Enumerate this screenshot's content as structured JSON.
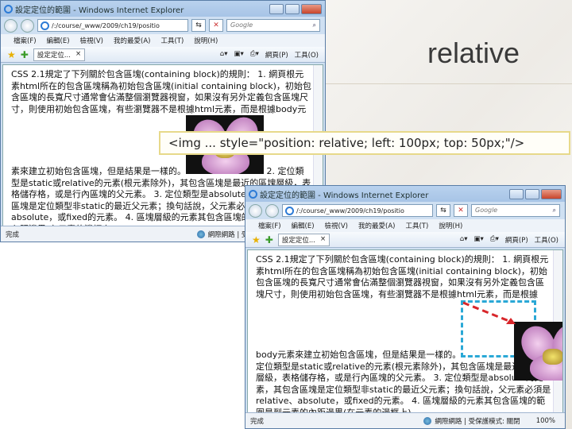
{
  "slide": {
    "title": "relative",
    "caption": "<img ... style=\"position: relative; left: 100px; top: 50px;\"/>"
  },
  "browser": {
    "window_title": "設定定位的範圍 - Windows Internet Explorer",
    "address": "/:/course/_www/2009/ch19/positio",
    "search_placeholder": "Google",
    "menu": [
      "檔案(F)",
      "編輯(E)",
      "檢視(V)",
      "我的最愛(A)",
      "工具(T)",
      "說明(H)"
    ],
    "tab_label": "設定定位...",
    "toolbar": {
      "page": "網頁(P)",
      "tools": "工具(O)"
    },
    "status": {
      "left": "完成",
      "zone": "網際網路 | 受保護模式: 關閉",
      "zoom": "100%"
    }
  },
  "page": {
    "para_before": "CSS 2.1規定了下列關於包含區塊(containing block)的規則： 1. 網頁根元素html所在的包含區塊稱為初始包含區塊(initial containing block)，初始包含區塊的長寬尺寸通常會佔滿整個瀏覽器視窗，如果沒有另外定義包含區塊尺寸，則使用初始包含區塊，有些瀏覽器不是根據html元素，而是根據body元素來建立初始包含區塊，但是結果是一樣的。",
    "para_after": " 2. 定位類型是static或relative的元素(根元素除外)，其包含區塊是最近的區塊層級，表格儲存格，或是行內區塊的父元素。 3. 定位類型是absolute的元素，其包含區塊是定位類型非static的最近父元素；換句話說，父元素必須是relative、absolute，或fixed的元素。 4. 區塊層級的元素其包含區塊的範圍是到元素的內距邊界(在元素的邊框上)。"
  }
}
